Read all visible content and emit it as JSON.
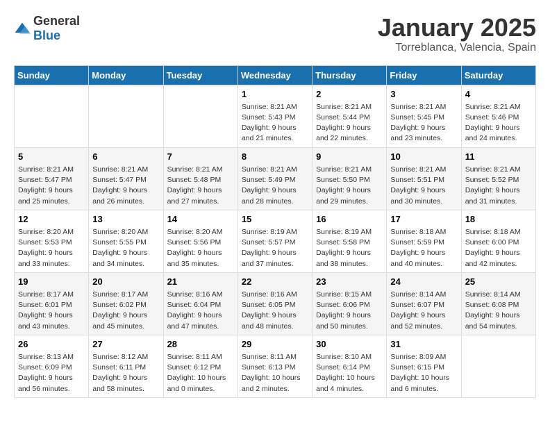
{
  "logo": {
    "general": "General",
    "blue": "Blue"
  },
  "title": "January 2025",
  "location": "Torreblanca, Valencia, Spain",
  "weekdays": [
    "Sunday",
    "Monday",
    "Tuesday",
    "Wednesday",
    "Thursday",
    "Friday",
    "Saturday"
  ],
  "weeks": [
    [
      {
        "day": "",
        "info": ""
      },
      {
        "day": "",
        "info": ""
      },
      {
        "day": "",
        "info": ""
      },
      {
        "day": "1",
        "info": "Sunrise: 8:21 AM\nSunset: 5:43 PM\nDaylight: 9 hours\nand 21 minutes."
      },
      {
        "day": "2",
        "info": "Sunrise: 8:21 AM\nSunset: 5:44 PM\nDaylight: 9 hours\nand 22 minutes."
      },
      {
        "day": "3",
        "info": "Sunrise: 8:21 AM\nSunset: 5:45 PM\nDaylight: 9 hours\nand 23 minutes."
      },
      {
        "day": "4",
        "info": "Sunrise: 8:21 AM\nSunset: 5:46 PM\nDaylight: 9 hours\nand 24 minutes."
      }
    ],
    [
      {
        "day": "5",
        "info": "Sunrise: 8:21 AM\nSunset: 5:47 PM\nDaylight: 9 hours\nand 25 minutes."
      },
      {
        "day": "6",
        "info": "Sunrise: 8:21 AM\nSunset: 5:47 PM\nDaylight: 9 hours\nand 26 minutes."
      },
      {
        "day": "7",
        "info": "Sunrise: 8:21 AM\nSunset: 5:48 PM\nDaylight: 9 hours\nand 27 minutes."
      },
      {
        "day": "8",
        "info": "Sunrise: 8:21 AM\nSunset: 5:49 PM\nDaylight: 9 hours\nand 28 minutes."
      },
      {
        "day": "9",
        "info": "Sunrise: 8:21 AM\nSunset: 5:50 PM\nDaylight: 9 hours\nand 29 minutes."
      },
      {
        "day": "10",
        "info": "Sunrise: 8:21 AM\nSunset: 5:51 PM\nDaylight: 9 hours\nand 30 minutes."
      },
      {
        "day": "11",
        "info": "Sunrise: 8:21 AM\nSunset: 5:52 PM\nDaylight: 9 hours\nand 31 minutes."
      }
    ],
    [
      {
        "day": "12",
        "info": "Sunrise: 8:20 AM\nSunset: 5:53 PM\nDaylight: 9 hours\nand 33 minutes."
      },
      {
        "day": "13",
        "info": "Sunrise: 8:20 AM\nSunset: 5:55 PM\nDaylight: 9 hours\nand 34 minutes."
      },
      {
        "day": "14",
        "info": "Sunrise: 8:20 AM\nSunset: 5:56 PM\nDaylight: 9 hours\nand 35 minutes."
      },
      {
        "day": "15",
        "info": "Sunrise: 8:19 AM\nSunset: 5:57 PM\nDaylight: 9 hours\nand 37 minutes."
      },
      {
        "day": "16",
        "info": "Sunrise: 8:19 AM\nSunset: 5:58 PM\nDaylight: 9 hours\nand 38 minutes."
      },
      {
        "day": "17",
        "info": "Sunrise: 8:18 AM\nSunset: 5:59 PM\nDaylight: 9 hours\nand 40 minutes."
      },
      {
        "day": "18",
        "info": "Sunrise: 8:18 AM\nSunset: 6:00 PM\nDaylight: 9 hours\nand 42 minutes."
      }
    ],
    [
      {
        "day": "19",
        "info": "Sunrise: 8:17 AM\nSunset: 6:01 PM\nDaylight: 9 hours\nand 43 minutes."
      },
      {
        "day": "20",
        "info": "Sunrise: 8:17 AM\nSunset: 6:02 PM\nDaylight: 9 hours\nand 45 minutes."
      },
      {
        "day": "21",
        "info": "Sunrise: 8:16 AM\nSunset: 6:04 PM\nDaylight: 9 hours\nand 47 minutes."
      },
      {
        "day": "22",
        "info": "Sunrise: 8:16 AM\nSunset: 6:05 PM\nDaylight: 9 hours\nand 48 minutes."
      },
      {
        "day": "23",
        "info": "Sunrise: 8:15 AM\nSunset: 6:06 PM\nDaylight: 9 hours\nand 50 minutes."
      },
      {
        "day": "24",
        "info": "Sunrise: 8:14 AM\nSunset: 6:07 PM\nDaylight: 9 hours\nand 52 minutes."
      },
      {
        "day": "25",
        "info": "Sunrise: 8:14 AM\nSunset: 6:08 PM\nDaylight: 9 hours\nand 54 minutes."
      }
    ],
    [
      {
        "day": "26",
        "info": "Sunrise: 8:13 AM\nSunset: 6:09 PM\nDaylight: 9 hours\nand 56 minutes."
      },
      {
        "day": "27",
        "info": "Sunrise: 8:12 AM\nSunset: 6:11 PM\nDaylight: 9 hours\nand 58 minutes."
      },
      {
        "day": "28",
        "info": "Sunrise: 8:11 AM\nSunset: 6:12 PM\nDaylight: 10 hours\nand 0 minutes."
      },
      {
        "day": "29",
        "info": "Sunrise: 8:11 AM\nSunset: 6:13 PM\nDaylight: 10 hours\nand 2 minutes."
      },
      {
        "day": "30",
        "info": "Sunrise: 8:10 AM\nSunset: 6:14 PM\nDaylight: 10 hours\nand 4 minutes."
      },
      {
        "day": "31",
        "info": "Sunrise: 8:09 AM\nSunset: 6:15 PM\nDaylight: 10 hours\nand 6 minutes."
      },
      {
        "day": "",
        "info": ""
      }
    ]
  ]
}
